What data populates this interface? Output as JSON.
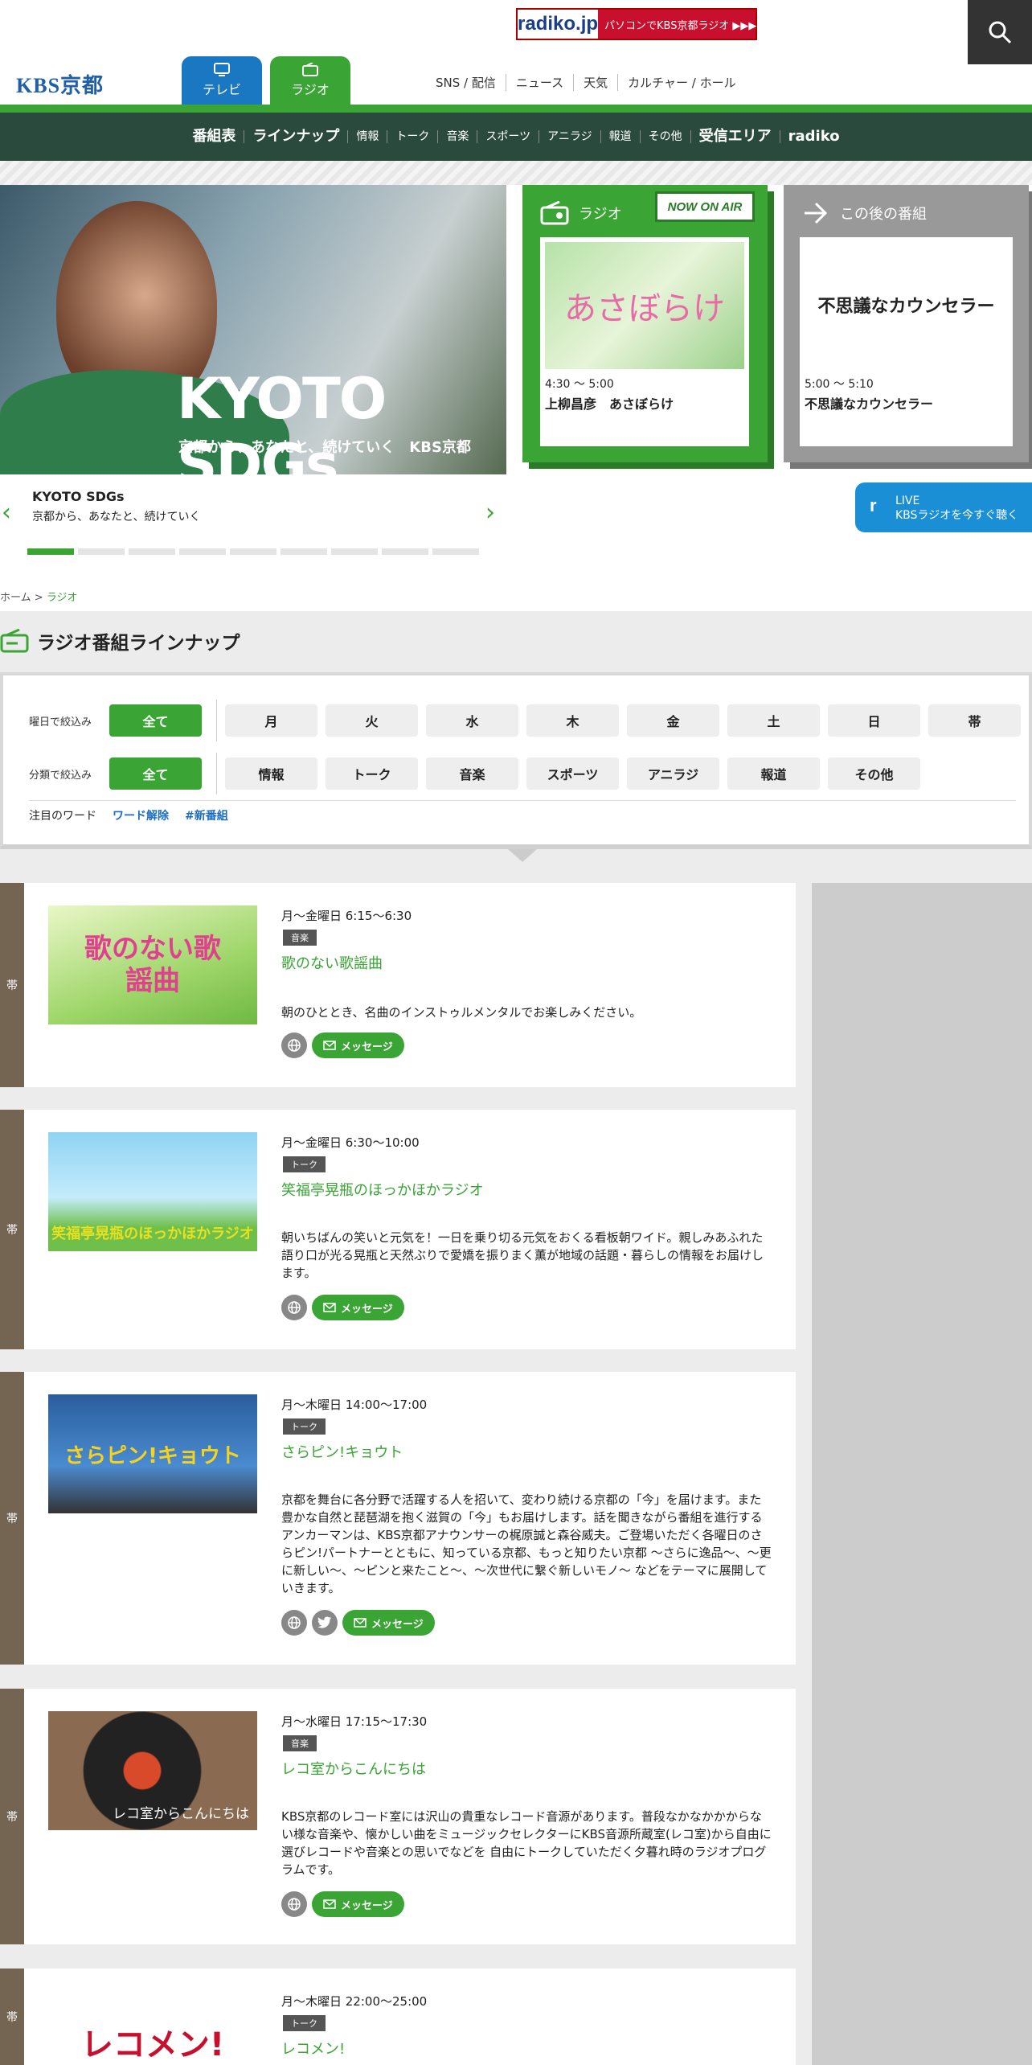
{
  "top": {
    "radiko_logo": "radiko.jp",
    "radiko_text": "パソコンでKBS京都ラジオ ▶▶▶"
  },
  "header": {
    "logo": "KBS京都",
    "tab_tv": "テレビ",
    "tab_radio": "ラジオ",
    "links": [
      "SNS / 配信",
      "ニュース",
      "天気",
      "カルチャー / ホール"
    ]
  },
  "nav": {
    "items": [
      "番組表",
      "ラインナップ",
      "情報",
      "トーク",
      "音楽",
      "スポーツ",
      "アニラジ",
      "報道",
      "その他",
      "受信エリア",
      "radiko"
    ]
  },
  "hero": {
    "logo_text": "KYOTO SDGs",
    "logo_sub": "京都から、あなたと、続けていく　KBS京都",
    "caption_title": "KYOTO SDGs",
    "caption_sub": "京都から、あなたと、続けていく",
    "slide_index": 1,
    "slide_count": 9
  },
  "onair": {
    "label": "ラジオ",
    "badge": "NOW ON AIR",
    "image_text": "あさぼらけ",
    "time": "4:30 〜 5:00",
    "name": "上柳昌彦　あさぼらけ"
  },
  "next": {
    "label": "この後の番組",
    "big": "不思議なカウンセラー",
    "time": "5:00 〜 5:10",
    "name": "不思議なカウンセラー"
  },
  "live": {
    "line1": "LIVE",
    "line2": "KBSラジオを今すぐ聴く"
  },
  "breadcrumb": {
    "home": "ホーム",
    "sep": ">",
    "current": "ラジオ"
  },
  "lineup": {
    "title": "ラジオ番組ラインナップ"
  },
  "filter": {
    "day_label": "曜日で絞込み",
    "all": "全て",
    "days": [
      "月",
      "火",
      "水",
      "木",
      "金",
      "土",
      "日",
      "帯"
    ],
    "cat_label": "分類で絞込み",
    "cats": [
      "情報",
      "トーク",
      "音楽",
      "スポーツ",
      "アニラジ",
      "報道",
      "その他"
    ],
    "kw_label": "注目のワード",
    "kw_clear": "ワード解除",
    "kw_tag": "#新番組"
  },
  "programs": [
    {
      "tag": "帯",
      "time": "月〜金曜日 6:15〜6:30",
      "cat": "音楽",
      "title": "歌のない歌謡曲",
      "thumb_text": "歌のない歌謡曲",
      "desc": "朝のひととき、名曲のインストゥルメンタルでお楽しみください。",
      "msg": "メッセージ"
    },
    {
      "tag": "帯",
      "time": "月〜金曜日 6:30〜10:00",
      "cat": "トーク",
      "title": "笑福亭晃瓶のほっかほかラジオ",
      "thumb_text": "笑福亭晃瓶のほっかほかラジオ",
      "desc": "朝いちばんの笑いと元気を！一日を乗り切る元気をおくる看板朝ワイド。親しみあふれた語り口が光る晃瓶と天然ぶりで愛嬌を振りまく薫が地域の話題・暮らしの情報をお届けします。",
      "msg": "メッセージ"
    },
    {
      "tag": "帯",
      "time": "月〜木曜日 14:00〜17:00",
      "cat": "トーク",
      "title": "さらピン!キョウト",
      "thumb_text": "さらピン!キョウト",
      "desc": "京都を舞台に各分野で活躍する人を招いて、変わり続ける京都の「今」を届けます。また豊かな自然と琵琶湖を抱く滋賀の「今」もお届けします。話を聞きながら番組を進行するアンカーマンは、KBS京都アナウンサーの梶原誠と森谷威夫。ご登場いただく各曜日のさらピン!パートナーとともに、知っている京都、もっと知りたい京都 〜さらに逸品〜、〜更に新しい〜、〜ピンと来たこと〜、〜次世代に繋ぐ新しいモノ〜 などをテーマに展開していきます。",
      "msg": "メッセージ"
    },
    {
      "tag": "帯",
      "time": "月〜水曜日 17:15〜17:30",
      "cat": "音楽",
      "title": "レコ室からこんにちは",
      "thumb_text": "レコ室からこんにちは",
      "desc": "KBS京都のレコード室には沢山の貴重なレコード音源があります。普段なかなかかからない様な音楽や、懐かしい曲をミュージックセレクターにKBS音源所蔵室(レコ室)から自由に選びレコードや音楽との思いでなどを 自由にトークしていただく夕暮れ時のラジオプログラムです。",
      "msg": "メッセージ"
    },
    {
      "tag": "帯",
      "time": "月〜木曜日 22:00〜25:00",
      "cat": "トーク",
      "title": "レコメン!",
      "thumb_text": "レコメン!",
      "desc": "",
      "msg": ""
    }
  ],
  "colors": {
    "green": "#3aa535",
    "dark_nav": "#2a4a3d",
    "tv_blue": "#1a78c2",
    "tag_brown": "#736551"
  }
}
